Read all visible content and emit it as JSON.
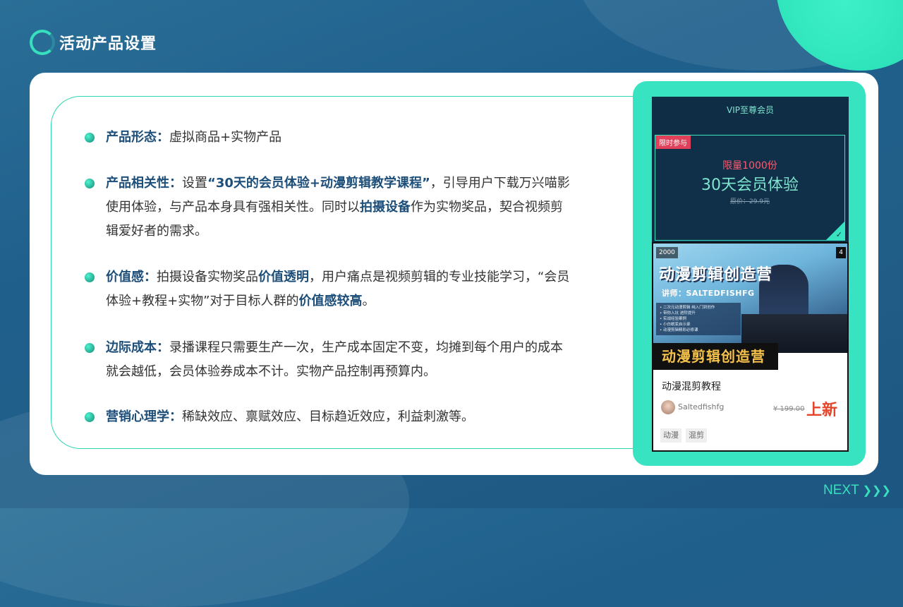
{
  "slide": {
    "title": "活动产品设置",
    "next_label": "NEXT",
    "next_arrows": "❯❯❯"
  },
  "bullets": [
    {
      "label": "产品形态：",
      "parts": [
        {
          "t": "虚拟商品+实物产品",
          "h": false
        }
      ]
    },
    {
      "label": "产品相关性：",
      "parts": [
        {
          "t": "设置",
          "h": false
        },
        {
          "t": "“30天的会员体验+动漫剪辑教学课程”",
          "h": true
        },
        {
          "t": "，引导用户下载万兴喵影使用体验，与产品本身具有强相关性。同时以",
          "h": false
        },
        {
          "t": "拍摄设备",
          "h": true
        },
        {
          "t": "作为实物奖品，契合视频剪辑爱好者的需求。",
          "h": false
        }
      ]
    },
    {
      "label": "价值感：",
      "parts": [
        {
          "t": "拍摄设备实物奖品",
          "h": false
        },
        {
          "t": "价值透明",
          "h": true
        },
        {
          "t": "，用户痛点是视频剪辑的专业技能学习，“会员体验+教程+实物”对于目标人群的",
          "h": false
        },
        {
          "t": "价值感较高",
          "h": true
        },
        {
          "t": "。",
          "h": false
        }
      ]
    },
    {
      "label": "边际成本：",
      "parts": [
        {
          "t": "录播课程只需要生产一次，生产成本固定不变，均摊到每个用户的成本就会越低，会员体验券成本不计。实物产品控制再预算内。",
          "h": false
        }
      ]
    },
    {
      "label": "营销心理学：",
      "parts": [
        {
          "t": "稀缺效应、禀赋效应、目标趋近效应，利益刺激等。",
          "h": false
        }
      ]
    }
  ],
  "phone": {
    "vip_title": "VIP至尊会员",
    "limited_tag": "限时参与",
    "limit_qty": "限量1000份",
    "vip_days": "30天会员体验",
    "orig_price": "原价：29.9元",
    "check": "✓",
    "course": {
      "thumb_number": "2000",
      "thumb_count": "4",
      "thumb_title": "动漫剪辑创造营",
      "thumb_teacher": "讲师：SALTEDFISHFG",
      "thumb_list": [
        "• 二次元动漫剪辑 纯入门到创作",
        "• 带你入坑 进阶提升",
        "• 实战经验案例",
        "• 小白蜕变启示录",
        "• 动漫剪辑精彩必修课"
      ],
      "banner": "动漫剪辑创造营",
      "name": "动漫混剪教程",
      "author": "Saltedfishfg",
      "old_price": "¥ 199.00",
      "new_label": "上新",
      "tags": [
        "动漫",
        "混剪"
      ]
    }
  },
  "colors": {
    "accent": "#37e3c1",
    "heading_blue": "#1d4f7a",
    "price_red": "#e2452a"
  }
}
